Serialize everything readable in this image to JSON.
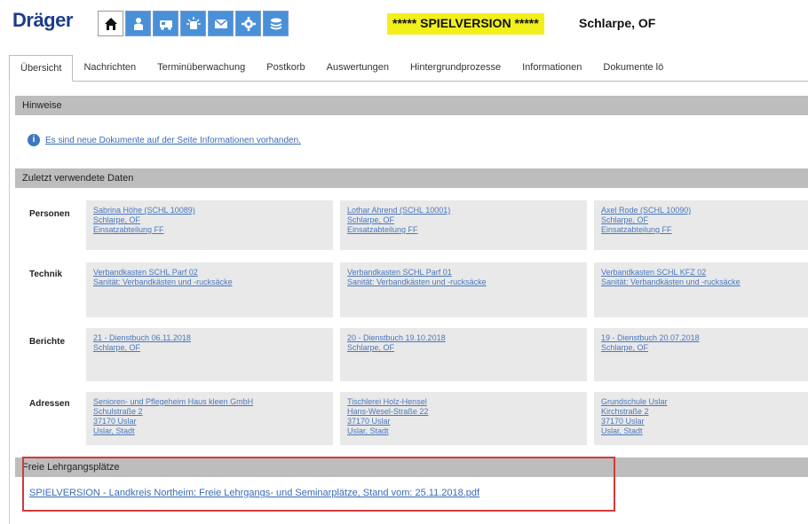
{
  "header": {
    "logo": "Dräger",
    "spielversion": "***** SPIELVERSION *****",
    "user": "Schlarpe, OF",
    "toolbar_icons": [
      "home-icon",
      "person-icon",
      "vehicle-icon",
      "alarm-icon",
      "mail-icon",
      "gear-icon",
      "layers-icon"
    ]
  },
  "tabs": [
    {
      "label": "Übersicht"
    },
    {
      "label": "Nachrichten"
    },
    {
      "label": "Terminüberwachung"
    },
    {
      "label": "Postkorb"
    },
    {
      "label": "Auswertungen"
    },
    {
      "label": "Hintergrundprozesse"
    },
    {
      "label": "Informationen"
    },
    {
      "label": "Dokumente lö"
    }
  ],
  "hinweise": {
    "title": "Hinweise",
    "notice": "Es sind neue Dokumente auf der Seite Informationen vorhanden."
  },
  "recent": {
    "title": "Zuletzt verwendete Daten",
    "rows": [
      {
        "label": "Personen",
        "cards": [
          [
            "Sabrina Höhe (SCHL 10089)",
            "Schlarpe, OF",
            "Einsatzabteilung FF"
          ],
          [
            "Lothar Ahrend (SCHL 10001)",
            "Schlarpe, OF",
            "Einsatzabteilung FF"
          ],
          [
            "Axel Rode (SCHL 10090)",
            "Schlarpe, OF",
            "Einsatzabteilung FF"
          ]
        ]
      },
      {
        "label": "Technik",
        "cards": [
          [
            "Verbandkasten SCHL Parf 02",
            "Sanität: Verbandkästen und -rucksäcke"
          ],
          [
            "Verbandkasten SCHL Parf 01",
            "Sanität: Verbandkästen und -rucksäcke"
          ],
          [
            "Verbandkasten SCHL KFZ 02",
            "Sanität: Verbandkästen und -rucksäcke"
          ]
        ]
      },
      {
        "label": "Berichte",
        "cards": [
          [
            "21 - Dienstbuch 06.11.2018",
            "Schlarpe, OF"
          ],
          [
            "20 - Dienstbuch 19.10.2018",
            "Schlarpe, OF"
          ],
          [
            "19 - Dienstbuch 20.07.2018",
            "Schlarpe, OF"
          ]
        ]
      },
      {
        "label": "Adressen",
        "cards": [
          [
            "Senioren- und Pflegeheim Haus kleen GmbH",
            "Schulstraße 2",
            "37170 Uslar",
            "Uslar, Stadt"
          ],
          [
            "Tischlerei Holz-Hensel",
            "Hans-Wesel-Straße 22",
            "37170 Uslar",
            "Uslar, Stadt"
          ],
          [
            "Grundschule Uslar",
            "Kirchstraße 2",
            "37170 Uslar",
            "Uslar, Stadt"
          ]
        ]
      }
    ]
  },
  "free": {
    "title": "Freie Lehrgangsplätze",
    "link": "SPIELVERSION - Landkreis Northeim: Freie Lehrgangs- und Seminarplätze, Stand vom: 25.11.2018.pdf"
  },
  "colors": {
    "accent": "#4a90d9",
    "section_header": "#bdbdbd",
    "highlight": "#f2f01a",
    "outline": "#d43a3a",
    "link": "#3b6bb5"
  }
}
